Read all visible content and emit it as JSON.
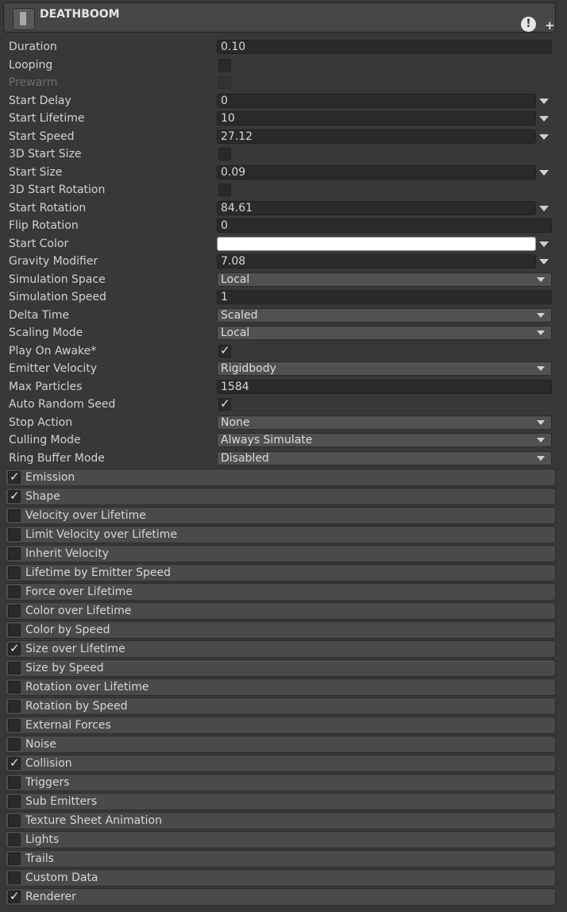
{
  "header": {
    "title": "DEATHBOOM",
    "warn_glyph": "!",
    "add_glyph": "+"
  },
  "props": [
    {
      "label": "Duration",
      "kind": "field",
      "value": "0.10",
      "arrow": false
    },
    {
      "label": "Looping",
      "kind": "toggle",
      "checked": false
    },
    {
      "label": "Prewarm",
      "kind": "toggle",
      "checked": false,
      "disabled": true
    },
    {
      "label": "Start Delay",
      "kind": "field",
      "value": "0",
      "arrow": true
    },
    {
      "label": "Start Lifetime",
      "kind": "field",
      "value": "10",
      "arrow": true
    },
    {
      "label": "Start Speed",
      "kind": "field",
      "value": "27.12",
      "arrow": true
    },
    {
      "label": "3D Start Size",
      "kind": "toggle",
      "checked": false
    },
    {
      "label": "Start Size",
      "kind": "field",
      "value": "0.09",
      "arrow": true
    },
    {
      "label": "3D Start Rotation",
      "kind": "toggle",
      "checked": false
    },
    {
      "label": "Start Rotation",
      "kind": "field",
      "value": "84.61",
      "arrow": true
    },
    {
      "label": "Flip Rotation",
      "kind": "field",
      "value": "0",
      "arrow": false
    },
    {
      "label": "Start Color",
      "kind": "color",
      "color": "#ffffff",
      "arrow": true
    },
    {
      "label": "Gravity Modifier",
      "kind": "field",
      "value": "7.08",
      "arrow": true
    },
    {
      "label": "Simulation Space",
      "kind": "select",
      "value": "Local"
    },
    {
      "label": "Simulation Speed",
      "kind": "field",
      "value": "1",
      "arrow": false
    },
    {
      "label": "Delta Time",
      "kind": "select",
      "value": "Scaled"
    },
    {
      "label": "Scaling Mode",
      "kind": "select",
      "value": "Local"
    },
    {
      "label": "Play On Awake*",
      "kind": "toggle",
      "checked": true
    },
    {
      "label": "Emitter Velocity",
      "kind": "select",
      "value": "Rigidbody"
    },
    {
      "label": "Max Particles",
      "kind": "field",
      "value": "1584",
      "arrow": false
    },
    {
      "label": "Auto Random Seed",
      "kind": "toggle",
      "checked": true
    },
    {
      "label": "Stop Action",
      "kind": "select",
      "value": "None"
    },
    {
      "label": "Culling Mode",
      "kind": "select",
      "value": "Always Simulate"
    },
    {
      "label": "Ring Buffer Mode",
      "kind": "select",
      "value": "Disabled"
    }
  ],
  "modules": [
    {
      "label": "Emission",
      "enabled": true
    },
    {
      "label": "Shape",
      "enabled": true
    },
    {
      "label": "Velocity over Lifetime",
      "enabled": false
    },
    {
      "label": "Limit Velocity over Lifetime",
      "enabled": false
    },
    {
      "label": "Inherit Velocity",
      "enabled": false
    },
    {
      "label": "Lifetime by Emitter Speed",
      "enabled": false
    },
    {
      "label": "Force over Lifetime",
      "enabled": false
    },
    {
      "label": "Color over Lifetime",
      "enabled": false
    },
    {
      "label": "Color by Speed",
      "enabled": false
    },
    {
      "label": "Size over Lifetime",
      "enabled": true
    },
    {
      "label": "Size by Speed",
      "enabled": false
    },
    {
      "label": "Rotation over Lifetime",
      "enabled": false
    },
    {
      "label": "Rotation by Speed",
      "enabled": false
    },
    {
      "label": "External Forces",
      "enabled": false
    },
    {
      "label": "Noise",
      "enabled": false
    },
    {
      "label": "Collision",
      "enabled": true
    },
    {
      "label": "Triggers",
      "enabled": false
    },
    {
      "label": "Sub Emitters",
      "enabled": false
    },
    {
      "label": "Texture Sheet Animation",
      "enabled": false
    },
    {
      "label": "Lights",
      "enabled": false
    },
    {
      "label": "Trails",
      "enabled": false
    },
    {
      "label": "Custom Data",
      "enabled": false
    },
    {
      "label": "Renderer",
      "enabled": true
    }
  ]
}
